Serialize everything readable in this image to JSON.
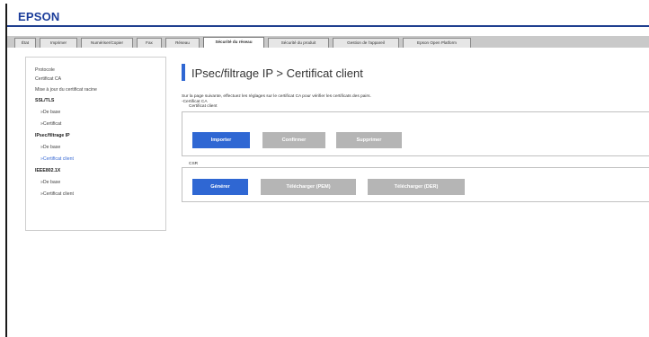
{
  "brand": {
    "logo": "EPSON",
    "accent": "#2f67d3",
    "header_line": "#1f3f8f"
  },
  "tabs": [
    {
      "label": "État",
      "active": false
    },
    {
      "label": "Imprimer",
      "active": false
    },
    {
      "label": "Numériser/Copier",
      "active": false
    },
    {
      "label": "Fax",
      "active": false
    },
    {
      "label": "Réseau",
      "active": false
    },
    {
      "label": "Sécurité du réseau",
      "active": true
    },
    {
      "label": "Sécurité du produit",
      "active": false
    },
    {
      "label": "Gestion de l'appareil",
      "active": false
    },
    {
      "label": "Epson Open Platform",
      "active": false
    }
  ],
  "sidebar": {
    "items": [
      {
        "label": "Protocole"
      },
      {
        "label": "Certificat CA"
      },
      {
        "label": "Mise à jour du certificat racine"
      },
      {
        "label": "SSL/TLS"
      },
      {
        "label": "»De base"
      },
      {
        "label": "»Certificat"
      },
      {
        "label": "IPsec/filtrage IP"
      },
      {
        "label": "»De base"
      },
      {
        "label": "»Certificat client"
      },
      {
        "label": "IEEE802.1X"
      },
      {
        "label": "»De base"
      },
      {
        "label": "»Certificat client"
      }
    ]
  },
  "main": {
    "title": "IPsec/filtrage IP > Certificat client",
    "description_line1": "Sur la page suivante, effectuez les réglages sur le certificat CA pour vérifier les certificats des pairs.",
    "description_line2": "-Certificat CA",
    "client_cert": {
      "legend": "Certificat client",
      "import_label": "Importer",
      "confirm_label": "Confirmer",
      "delete_label": "Supprimer"
    },
    "csr": {
      "legend": "CSR",
      "generate_label": "Générer",
      "download_pem_label": "Télécharger (PEM)",
      "download_der_label": "Télécharger (DER)"
    }
  }
}
